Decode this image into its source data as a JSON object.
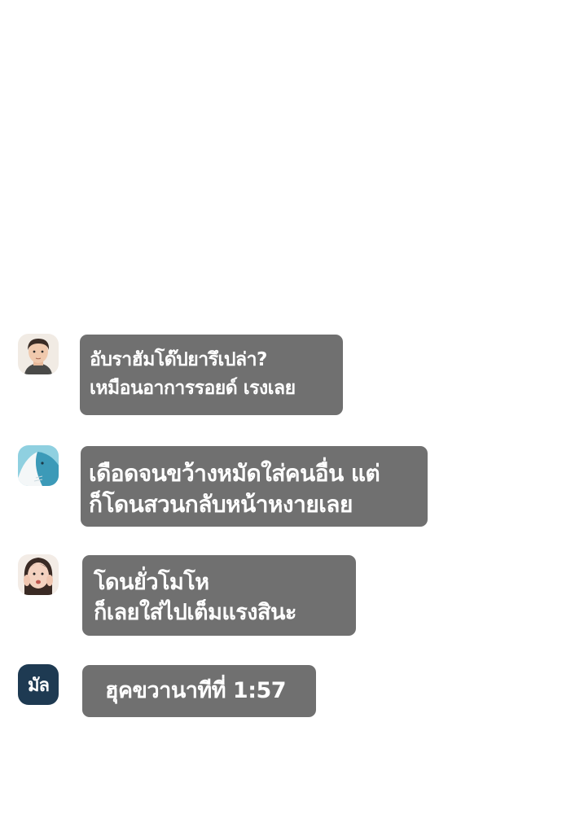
{
  "messages": [
    {
      "sender_icon": "man-avatar-icon",
      "lines": [
        "อับราฮัมโด๊ปยารึเปล่า?",
        "เหมือนอาการรอยด์ เรงเลย"
      ]
    },
    {
      "sender_icon": "whale-avatar-icon",
      "lines": [
        "เดือดจนขว้างหมัดใส่คนอื่น แต่",
        "ก็โดนสวนกลับหน้าหงายเลย"
      ]
    },
    {
      "sender_icon": "woman-avatar-icon",
      "lines": [
        "โดนยั่วโมโห",
        "ก็เลยใส่ไปเต็มแรงสินะ"
      ]
    },
    {
      "sender_icon": "badge-avatar-icon",
      "avatar_text": "มัล",
      "lines": [
        "ฮุคขวานาทีที่ 1:57"
      ]
    }
  ],
  "colors": {
    "bubble": "#707070",
    "bubble_text": "#ffffff",
    "badge": "#1e3a52"
  }
}
